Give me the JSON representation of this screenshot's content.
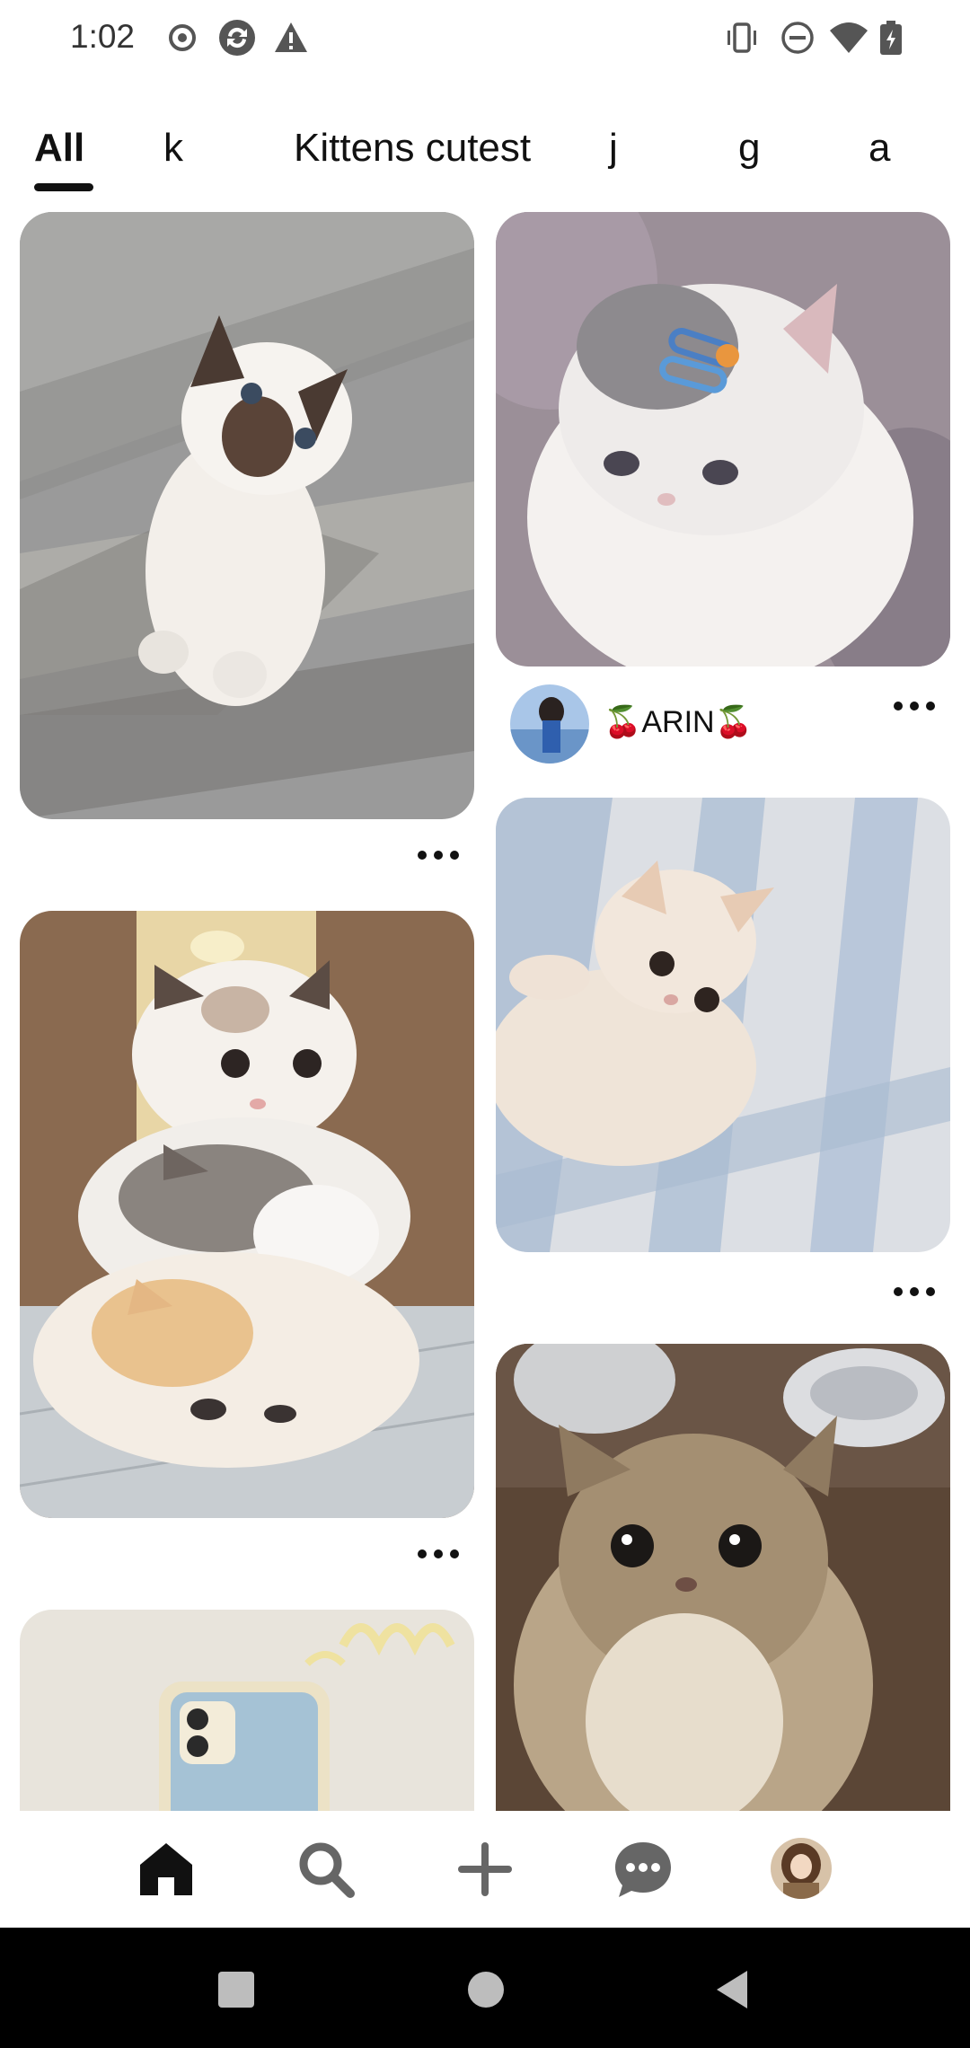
{
  "status_bar": {
    "time": "1:02",
    "left_icons": [
      "record-icon",
      "sync-icon",
      "warning-icon"
    ],
    "right_icons": [
      "vibrate-icon",
      "dnd-icon",
      "wifi-icon",
      "battery-icon"
    ]
  },
  "tabs": [
    {
      "label": "All",
      "selected": true
    },
    {
      "label": "k",
      "selected": false
    },
    {
      "label": "Kittens cutest",
      "selected": false
    },
    {
      "label": "j",
      "selected": false
    },
    {
      "label": "g",
      "selected": false
    },
    {
      "label": "a",
      "selected": false
    }
  ],
  "feed": {
    "pins": [
      {
        "id": "ragdoll-kitten-floor",
        "column": "left",
        "has_more_button": true
      },
      {
        "id": "fluffy-kitten-hair-clips",
        "column": "right",
        "author": "🍒ARIN🍒",
        "has_more_button": true
      },
      {
        "id": "cream-kitten-blanket",
        "column": "right",
        "has_more_button": true
      },
      {
        "id": "three-stacked-cats",
        "column": "left",
        "has_more_button": true
      },
      {
        "id": "persian-kitten-wood-floor",
        "column": "right",
        "has_more_button": false
      },
      {
        "id": "phone-case-partial",
        "column": "left",
        "has_more_button": false
      }
    ]
  },
  "bottom_nav": {
    "items": [
      "home-icon",
      "search-icon",
      "create-icon",
      "messages-icon",
      "profile-avatar"
    ],
    "active": "home-icon"
  },
  "system_nav": [
    "recents-button",
    "home-button",
    "back-button"
  ]
}
